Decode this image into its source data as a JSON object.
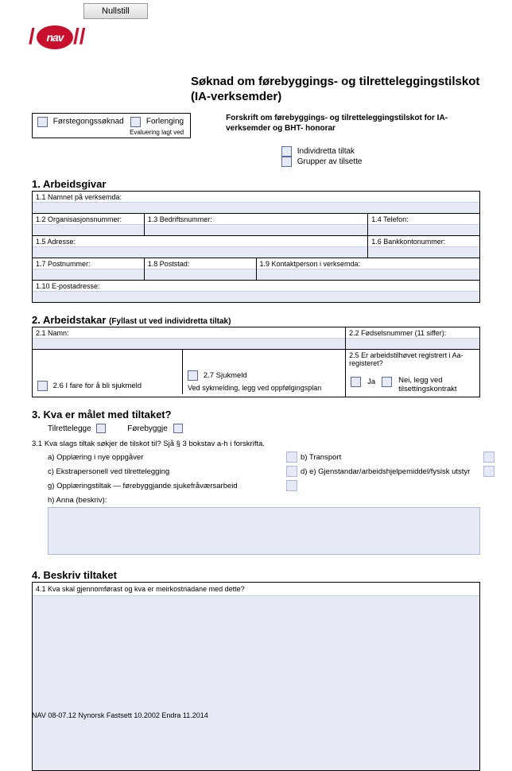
{
  "buttons": {
    "reset": "Nullstill"
  },
  "logo": {
    "text": "nav"
  },
  "title": "Søknad om førebyggings- og tilretteleggingstilskot (IA-verksemder)",
  "apptype": {
    "first": "Førstegongssøknad",
    "ext": "Forlenging",
    "eval": "Evaluering lagt ved"
  },
  "subtitle": "Forskrift om førebyggings- og tilretteleggingstilskot for IA-verksemder og BHT- honorar",
  "tiltak": {
    "indiv": "Individretta tiltak",
    "gruppe": "Grupper av tilsette"
  },
  "sec1": {
    "heading": "1. Arbeidsgivar",
    "f11": "1.1 Namnet på verksemda:",
    "f12": "1.2 Organisasjonsnummer:",
    "f13": "1.3 Bedriftsnummer:",
    "f14": "1.4 Telefon:",
    "f15": "1.5 Adresse:",
    "f16": "1.6 Bankkontonummer:",
    "f17": "1.7 Postnummer:",
    "f18": "1.8 Poststad:",
    "f19": "1.9 Kontaktperson i verksemda:",
    "f110": "1.10 E-postadresse:"
  },
  "sec2": {
    "heading": "2. Arbeidstakar",
    "heading_sub": "(Fyllast ut ved individretta tiltak)",
    "f21": "2.1 Namn:",
    "f22": "2.2 Fødselsnummer (11 siffer):",
    "f25": "2.5 Er arbeidstilhøvet registrert i Aa-registeret?",
    "f26": "2.6 I fare for å bli sjukmeld",
    "f27": "2.7 Sjukmeld",
    "note27": "Ved sykmelding, legg ved oppfølgingsplan",
    "ja": "Ja",
    "nei": "Nei, legg ved tilsettingskontrakt"
  },
  "sec3": {
    "heading": "3. Kva er målet med tiltaket?",
    "opt_t": "Tilrettelegge",
    "opt_f": "Førebyggje",
    "f31": "3.1 Kva slags tiltak søkjer de tilskot til? Sjå § 3 bokstav a-h i forskrifta.",
    "a": "a) Opplæring i nye oppgåver",
    "b": "b) Transport",
    "c": "c) Ekstrapersonell ved tilrettelegging",
    "de": "d) e) Gjenstandar/arbeidshjelpemiddel/fysisk utstyr",
    "g": "g) Opplæringstiltak — førebyggjande sjukefråværsarbeid",
    "h": "h) Anna (beskriv):"
  },
  "sec4": {
    "heading": "4. Beskriv tiltaket",
    "f41": "4.1 Kva skal gjennomførast og kva er meirkostnadane med dette?"
  },
  "footer": "NAV 08-07.12 Nynorsk Fastsett 10.2002 Endra 11.2014"
}
